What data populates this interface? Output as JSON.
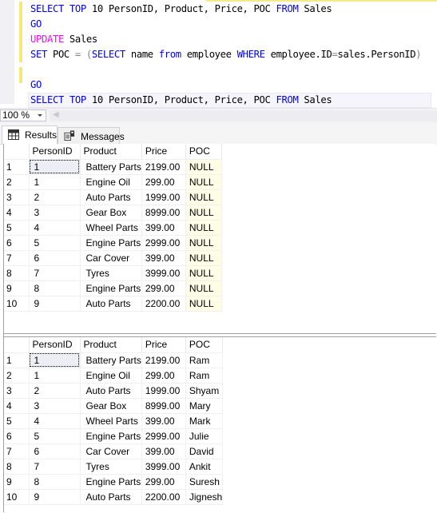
{
  "editor": {
    "lines": [
      {
        "tokens": [
          {
            "t": "SELECT",
            "c": "kw"
          },
          {
            "t": " "
          },
          {
            "t": "TOP",
            "c": "kw"
          },
          {
            "t": " 10 PersonID, Product, Price, POC "
          },
          {
            "t": "FROM",
            "c": "kw"
          },
          {
            "t": " Sales"
          }
        ]
      },
      {
        "tokens": [
          {
            "t": "GO",
            "c": "kw"
          }
        ]
      },
      {
        "tokens": [
          {
            "t": "UPDATE",
            "c": "kw2"
          },
          {
            "t": " Sales"
          }
        ]
      },
      {
        "tokens": [
          {
            "t": "SET",
            "c": "kw"
          },
          {
            "t": " POC "
          },
          {
            "t": "=",
            "c": "op"
          },
          {
            "t": " "
          },
          {
            "t": "(",
            "c": "op"
          },
          {
            "t": "SELECT",
            "c": "kw"
          },
          {
            "t": " name "
          },
          {
            "t": "from",
            "c": "kw"
          },
          {
            "t": " employee "
          },
          {
            "t": "WHERE",
            "c": "kw"
          },
          {
            "t": " employee.ID"
          },
          {
            "t": "=",
            "c": "op"
          },
          {
            "t": "sales.PersonID"
          },
          {
            "t": ")",
            "c": "op"
          }
        ]
      },
      {
        "tokens": []
      },
      {
        "tokens": [
          {
            "t": "GO",
            "c": "kw"
          }
        ]
      },
      {
        "tokens": [
          {
            "t": "SELECT",
            "c": "kw"
          },
          {
            "t": " "
          },
          {
            "t": "TOP",
            "c": "kw"
          },
          {
            "t": " 10 PersonID, Product, Price, POC "
          },
          {
            "t": "FROM",
            "c": "kw"
          },
          {
            "t": " Sales"
          }
        ]
      }
    ]
  },
  "zoom": {
    "value": "100 %"
  },
  "tabs": {
    "results": {
      "label": "Results",
      "icon": "grid-icon"
    },
    "messages": {
      "label": "Messages",
      "icon": "messages-icon"
    }
  },
  "grid1": {
    "columns": [
      "PersonID",
      "Product",
      "Price",
      "POC"
    ],
    "rows": [
      [
        "1",
        "1",
        "Battery Parts",
        "2199.00",
        "NULL"
      ],
      [
        "2",
        "1",
        "Engine Oil",
        "299.00",
        "NULL"
      ],
      [
        "3",
        "2",
        "Auto Parts",
        "1999.00",
        "NULL"
      ],
      [
        "4",
        "3",
        "Gear Box",
        "8999.00",
        "NULL"
      ],
      [
        "5",
        "4",
        "Wheel Parts",
        "399.00",
        "NULL"
      ],
      [
        "6",
        "5",
        "Engine Parts",
        "2999.00",
        "NULL"
      ],
      [
        "7",
        "6",
        "Car Cover",
        "399.00",
        "NULL"
      ],
      [
        "8",
        "7",
        "Tyres",
        "3999.00",
        "NULL"
      ],
      [
        "9",
        "8",
        "Engine Parts",
        "299.00",
        "NULL"
      ],
      [
        "10",
        "9",
        "Auto Parts",
        "2200.00",
        "NULL"
      ]
    ]
  },
  "grid2": {
    "columns": [
      "PersonID",
      "Product",
      "Price",
      "POC"
    ],
    "rows": [
      [
        "1",
        "1",
        "Battery Parts",
        "2199.00",
        "Ram"
      ],
      [
        "2",
        "1",
        "Engine Oil",
        "299.00",
        "Ram"
      ],
      [
        "3",
        "2",
        "Auto Parts",
        "1999.00",
        "Shyam"
      ],
      [
        "4",
        "3",
        "Gear Box",
        "8999.00",
        "Mary"
      ],
      [
        "5",
        "4",
        "Wheel Parts",
        "399.00",
        "Mark"
      ],
      [
        "6",
        "5",
        "Engine Parts",
        "2999.00",
        "Julie"
      ],
      [
        "7",
        "6",
        "Car Cover",
        "399.00",
        "David"
      ],
      [
        "8",
        "7",
        "Tyres",
        "3999.00",
        "Ankit"
      ],
      [
        "9",
        "8",
        "Engine Parts",
        "299.00",
        "Suresh"
      ],
      [
        "10",
        "9",
        "Auto Parts",
        "2200.00",
        "Jignesh"
      ]
    ]
  },
  "colors": {
    "keyword": "#0000ff",
    "dml_keyword": "#ff00ff",
    "null_cell_bg": "#fffde6",
    "change_marker": "#f4e97a"
  }
}
